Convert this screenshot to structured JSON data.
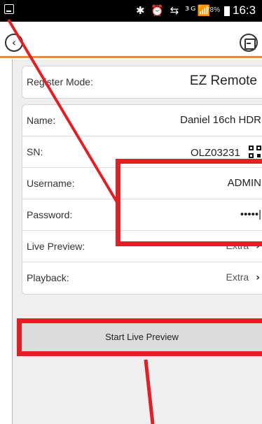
{
  "status_bar": {
    "icons": "✱ ⏰ ⇆ ³ᴳ📶",
    "battery": "78%",
    "time": "16:3"
  },
  "form": {
    "register_mode": {
      "label": "Register Mode:",
      "value": "EZ Remote"
    },
    "name": {
      "label": "Name:",
      "value": "Daniel 16ch HDR"
    },
    "sn": {
      "label": "SN:",
      "value": "OLZ03231"
    },
    "username": {
      "label": "Username:",
      "value": "ADMIN"
    },
    "password": {
      "label": "Password:",
      "value": "•••••|"
    },
    "live_preview": {
      "label": "Live Preview:",
      "value": "Extra"
    },
    "playback": {
      "label": "Playback:",
      "value": "Extra"
    }
  },
  "start_button_label": "Start Live Preview",
  "icons": {
    "back": "chevron-left-icon",
    "save": "save-icon",
    "qr": "qr-code-icon",
    "chevron": "chevron-right-icon"
  },
  "colors": {
    "accent": "#e98b3a",
    "annotation_red": "#e31e24",
    "background": "#efefef"
  }
}
